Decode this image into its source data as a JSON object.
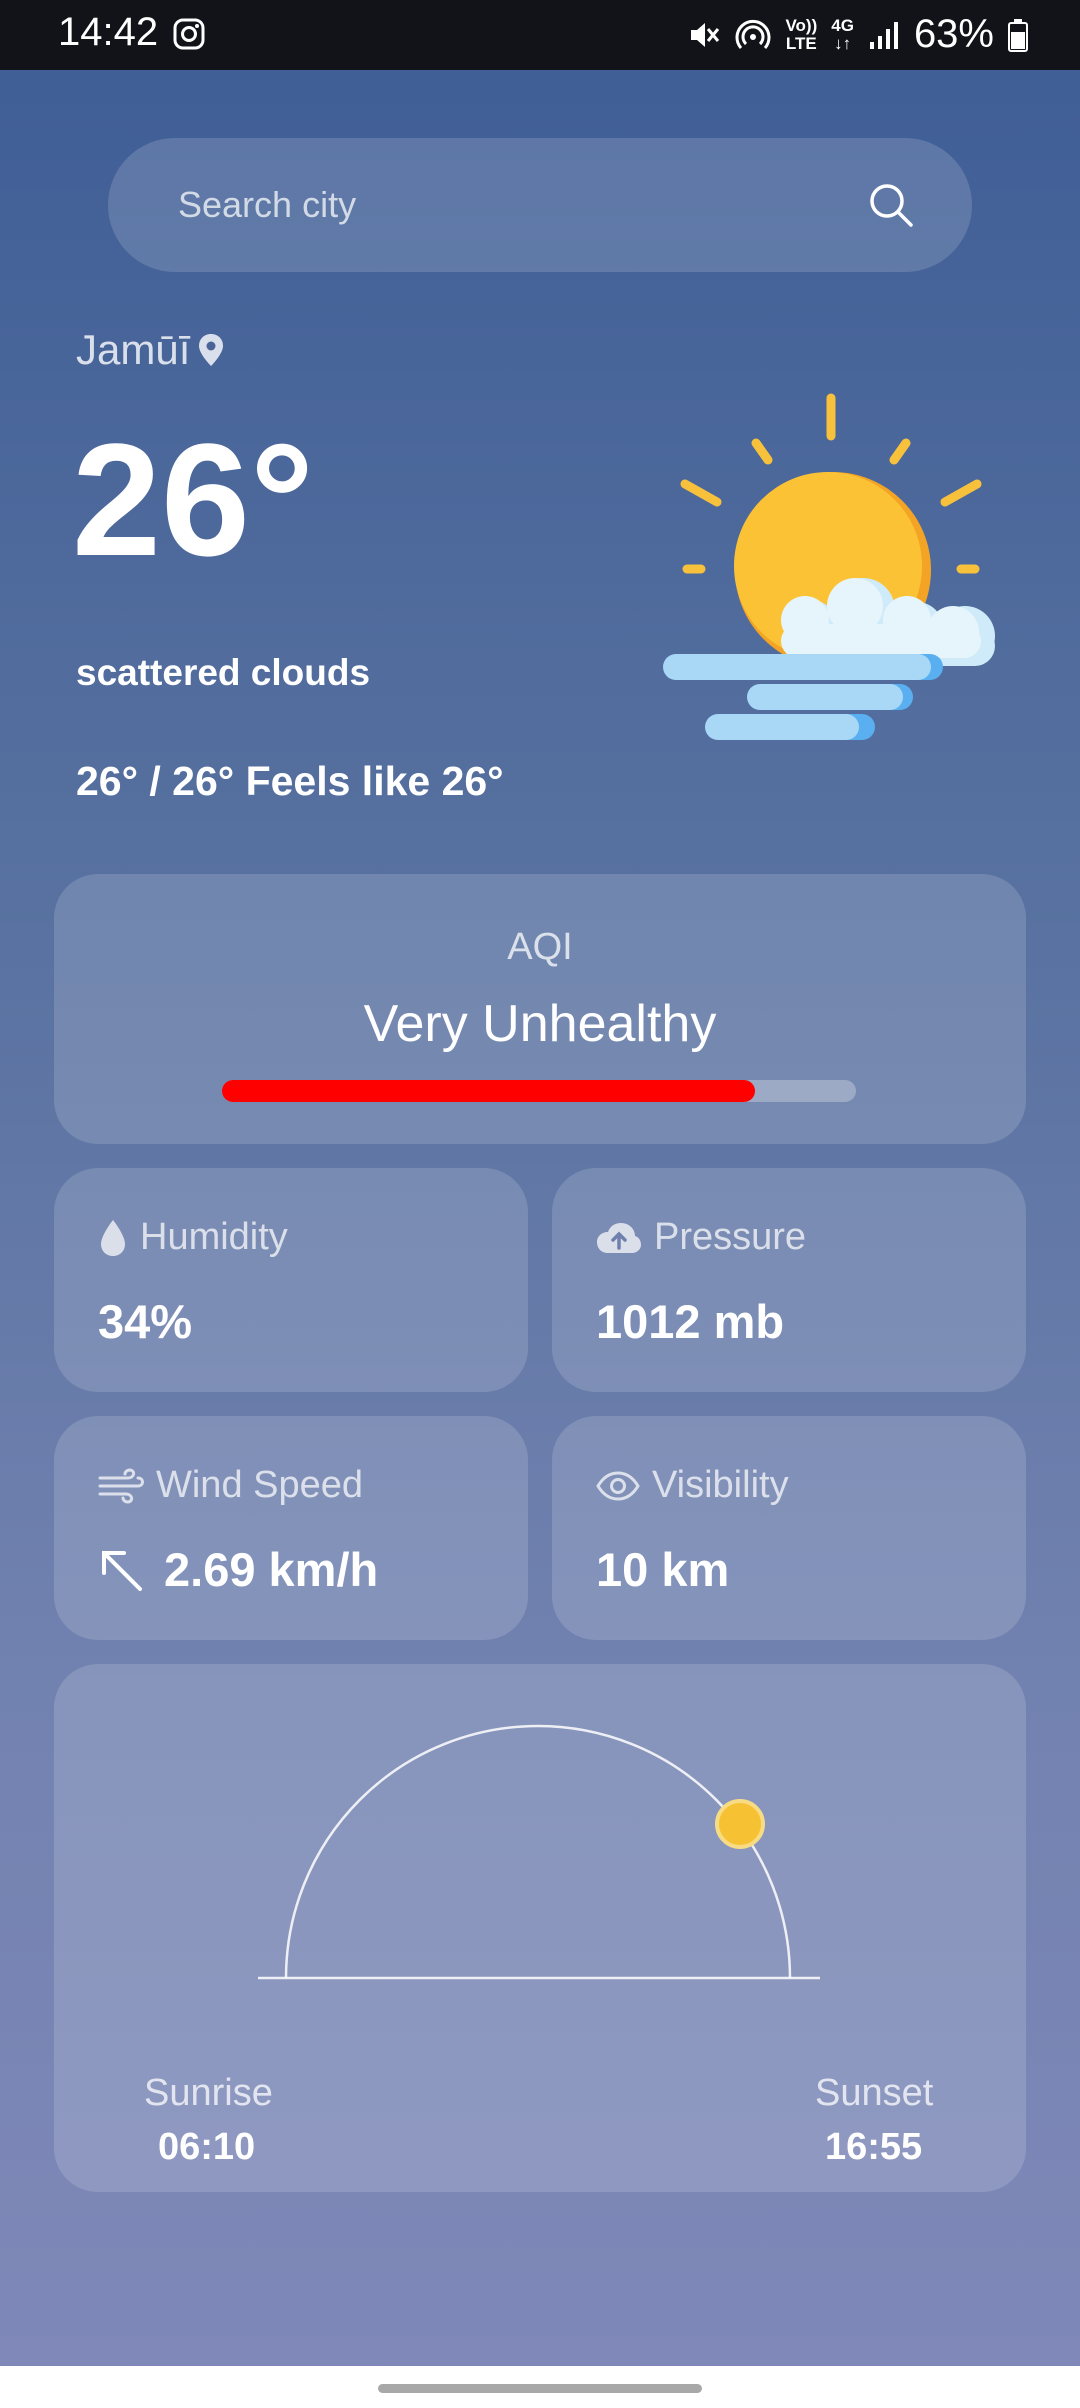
{
  "status_bar": {
    "time": "14:42",
    "volte_top": "Vo))",
    "volte_bottom": "LTE",
    "network": "4G",
    "battery": "63%"
  },
  "search": {
    "placeholder": "Search city"
  },
  "location": {
    "city": "Jamūī"
  },
  "current": {
    "temperature": "26°",
    "description": "scattered clouds",
    "min_max_feels": "26° / 26° Feels like 26°",
    "icon": "sun-behind-cloud-icon"
  },
  "aqi": {
    "label": "AQI",
    "value": "Very Unhealthy",
    "level": 0.84,
    "bar_color": "#ff0000"
  },
  "stats": {
    "humidity": {
      "label": "Humidity",
      "value": "34%",
      "icon": "water-drop-icon"
    },
    "pressure": {
      "label": "Pressure",
      "value": "1012 mb",
      "icon": "cloud-upload-icon"
    },
    "wind": {
      "label": "Wind Speed",
      "value": "2.69 km/h",
      "icon": "wind-icon",
      "direction_icon": "arrow-up-left-icon"
    },
    "visibility": {
      "label": "Visibility",
      "value": "10 km",
      "icon": "eye-icon"
    }
  },
  "sun": {
    "sunrise_label": "Sunrise",
    "sunrise_time": "06:10",
    "sunset_label": "Sunset",
    "sunset_time": "16:55",
    "sun_color": "#f6c233"
  }
}
